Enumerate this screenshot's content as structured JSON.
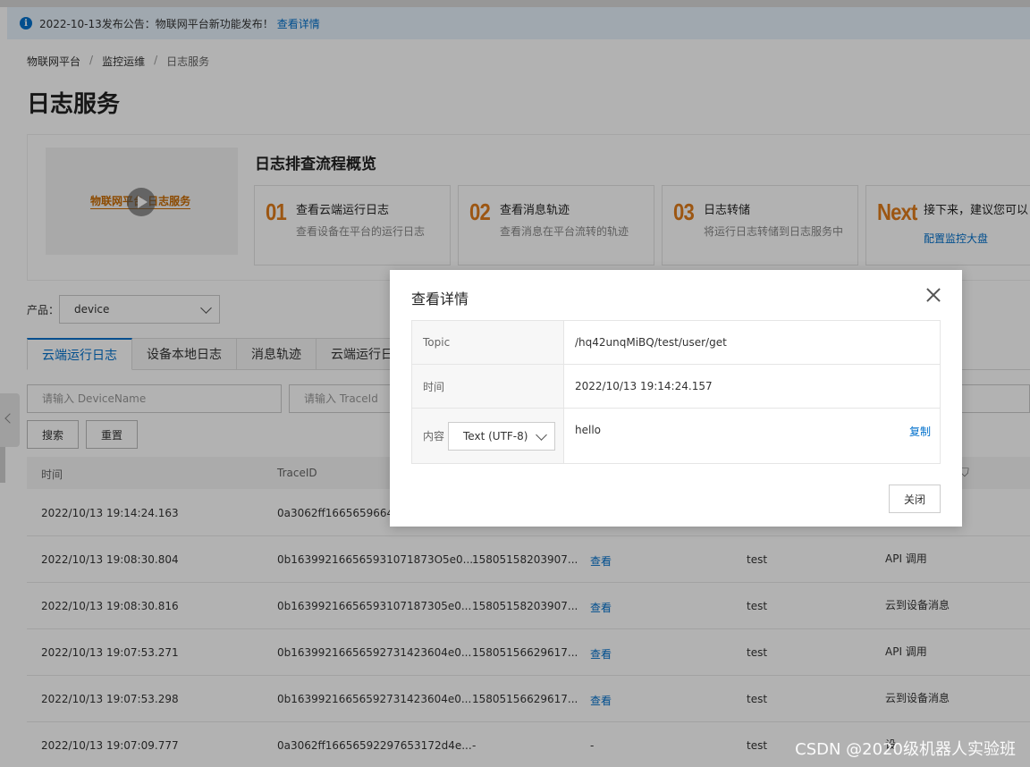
{
  "notice": {
    "text": "2022-10-13发布公告：物联网平台新功能发布！",
    "link": "查看详情"
  },
  "breadcrumb": {
    "items": [
      "物联网平台",
      "监控运维",
      "日志服务"
    ],
    "separator": "/"
  },
  "page_title": "日志服务",
  "overview": {
    "video_label": "物联网平台 日志服务",
    "title": "日志排查流程概览",
    "steps": [
      {
        "num": "01",
        "title": "查看云端运行日志",
        "desc": "查看设备在平台的运行日志"
      },
      {
        "num": "02",
        "title": "查看消息轨迹",
        "desc": "查看消息在平台流转的轨迹"
      },
      {
        "num": "03",
        "title": "日志转储",
        "desc": "将运行日志转储到日志服务中"
      },
      {
        "num": "Next",
        "title": "接下来，建议您可以",
        "link": "配置监控大盘"
      }
    ]
  },
  "filter": {
    "product_label": "产品：",
    "product_value": "device"
  },
  "tabs": [
    "云端运行日志",
    "设备本地日志",
    "消息轨迹",
    "云端运行日"
  ],
  "search": {
    "device_placeholder": "请输入 DeviceName",
    "trace_placeholder": "请输入 TraceId",
    "search_label": "搜索",
    "reset_label": "重置"
  },
  "table": {
    "headers": [
      "时间",
      "TraceID"
    ],
    "rows": [
      {
        "time": "2022/10/13 19:14:24.163",
        "trace": "0a3062ff16656596641",
        "msgid": "",
        "action": "",
        "device": "",
        "type": ""
      },
      {
        "time": "2022/10/13 19:08:30.804",
        "trace": "0b163992166565931071873O5e0...",
        "msgid": "15805158203907...",
        "action": "查看",
        "device": "test",
        "type": "API 调用"
      },
      {
        "time": "2022/10/13 19:08:30.816",
        "trace": "0b16399216656593107187305e0...",
        "msgid": "15805158203907...",
        "action": "查看",
        "device": "test",
        "type": "云到设备消息"
      },
      {
        "time": "2022/10/13 19:07:53.271",
        "trace": "0b16399216656592731423604e0...",
        "msgid": "15805156629617...",
        "action": "查看",
        "device": "test",
        "type": "API 调用"
      },
      {
        "time": "2022/10/13 19:07:53.298",
        "trace": "0b16399216656592731423604e0...",
        "msgid": "15805156629617...",
        "action": "查看",
        "device": "test",
        "type": "云到设备消息"
      },
      {
        "time": "2022/10/13 19:07:09.777",
        "trace": "0a3062ff16656592297653172d4e...",
        "msgid": "-",
        "action": "-",
        "device": "test",
        "type": "设"
      }
    ]
  },
  "modal": {
    "title": "查看详情",
    "topic_label": "Topic",
    "topic_value": "/hq42unqMiBQ/test/user/get",
    "time_label": "时间",
    "time_value": "2022/10/13 19:14:24.157",
    "content_label": "内容",
    "encoding": "Text (UTF-8)",
    "content_value": "hello",
    "copy_label": "复制",
    "close_label": "关闭"
  },
  "watermark": "CSDN @2020级机器人实验班"
}
